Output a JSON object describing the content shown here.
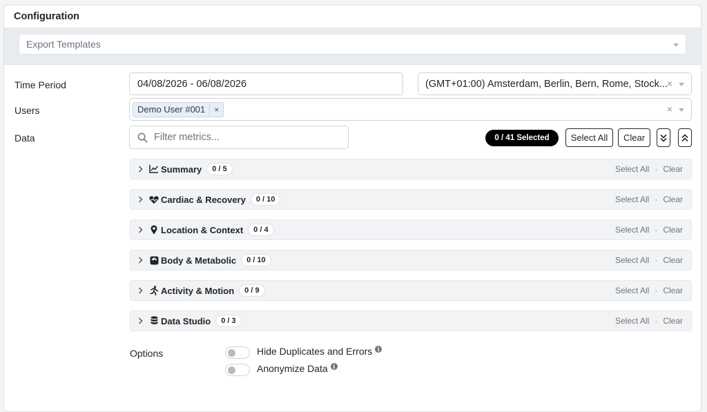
{
  "header": {
    "title": "Configuration"
  },
  "templates": {
    "placeholder": "Export Templates"
  },
  "time_period": {
    "label": "Time Period",
    "range": "04/08/2026 - 06/08/2026",
    "timezone": "(GMT+01:00) Amsterdam, Berlin, Bern, Rome, Stock..."
  },
  "users": {
    "label": "Users",
    "chips": [
      "Demo User #001"
    ]
  },
  "data": {
    "label": "Data",
    "filter_placeholder": "Filter metrics...",
    "selected_badge": "0 / 41 Selected",
    "select_all_label": "Select All",
    "clear_label": "Clear"
  },
  "groups": [
    {
      "title": "Summary",
      "count": "0 / 5",
      "icon": "chart-line-icon"
    },
    {
      "title": "Cardiac & Recovery",
      "count": "0 / 10",
      "icon": "heart-pulse-icon"
    },
    {
      "title": "Location & Context",
      "count": "0 / 4",
      "icon": "map-pin-icon"
    },
    {
      "title": "Body & Metabolic",
      "count": "0 / 10",
      "icon": "scale-icon"
    },
    {
      "title": "Activity & Motion",
      "count": "0 / 9",
      "icon": "running-person-icon"
    },
    {
      "title": "Data Studio",
      "count": "0 / 3",
      "icon": "database-icon"
    }
  ],
  "group_actions": {
    "select_all": "Select All",
    "separator": "·",
    "clear": "Clear"
  },
  "options": {
    "label": "Options",
    "items": [
      {
        "label": "Hide Duplicates and Errors",
        "enabled": false
      },
      {
        "label": "Anonymize Data",
        "enabled": false
      }
    ]
  }
}
